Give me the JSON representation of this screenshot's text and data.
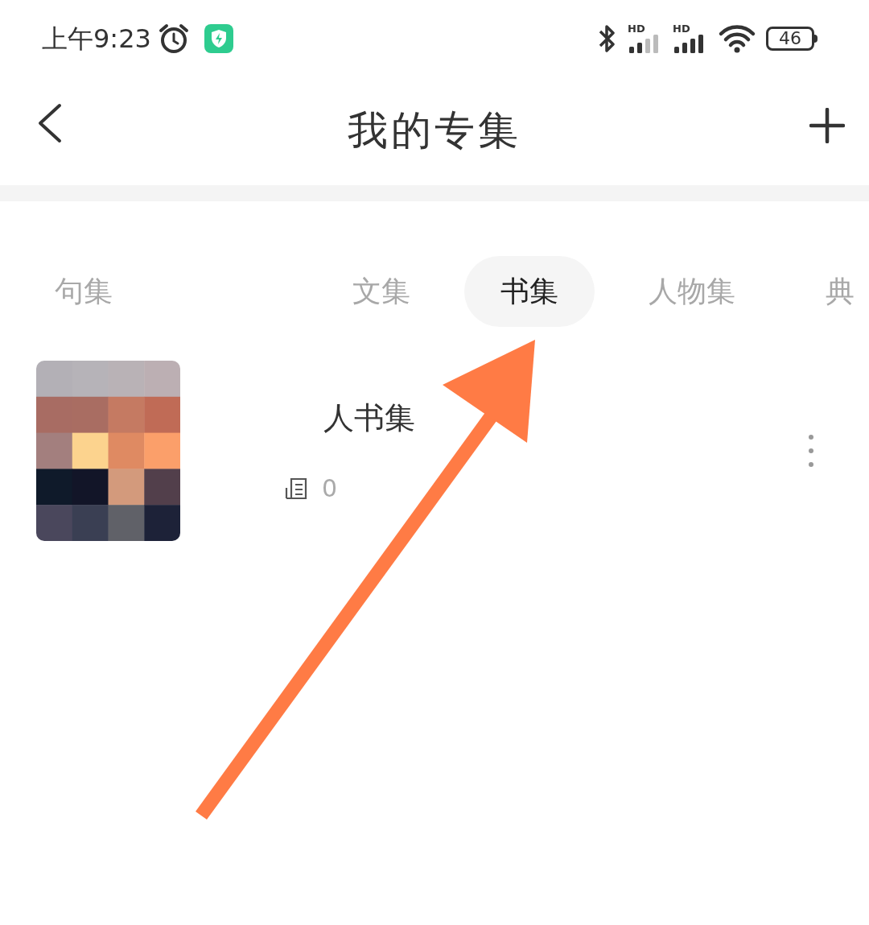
{
  "status_bar": {
    "time": "上午9:23",
    "signals": [
      {
        "label": "HD"
      },
      {
        "label": "HD"
      }
    ],
    "battery": "46"
  },
  "header": {
    "title": "我的专集"
  },
  "tabs": [
    {
      "label": "句集",
      "selected": false
    },
    {
      "label": "文集",
      "selected": false
    },
    {
      "label": "书集",
      "selected": true
    },
    {
      "label": "人物集",
      "selected": false
    },
    {
      "label": "典",
      "selected": false
    }
  ],
  "collections": [
    {
      "title": "人书集",
      "count": "0"
    }
  ]
}
